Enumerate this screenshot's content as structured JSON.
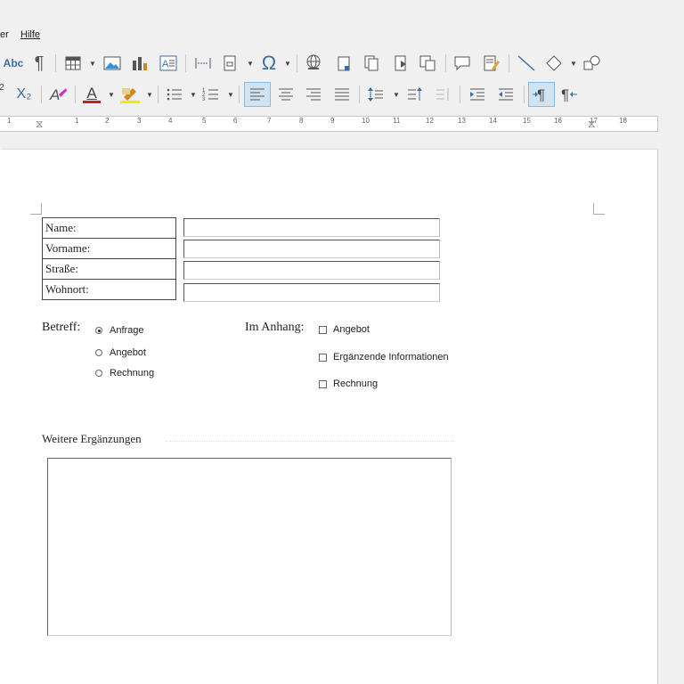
{
  "menu": {
    "item_partial": "er",
    "help": "Hilfe"
  },
  "toolbar1": {
    "spelling_icon": "Abc",
    "pilcrow_icon": "¶",
    "special_char_icon": "Ω"
  },
  "toolbar2": {
    "superscript_icon": "2",
    "subscript_icon": "X₂",
    "font_color_icon": "A",
    "highlight_color": "#f6e600",
    "font_color_bar": "#c9211e"
  },
  "ruler": {
    "numbers": [
      "1",
      "1",
      "2",
      "3",
      "4",
      "5",
      "6",
      "7",
      "8",
      "9",
      "10",
      "11",
      "12",
      "13",
      "14",
      "15",
      "16",
      "17",
      "18"
    ]
  },
  "form": {
    "personal_labels": [
      "Name:",
      "Vorname:",
      "Straße:",
      "Wohnort:"
    ],
    "subject_label": "Betreff:",
    "subject_options": [
      {
        "label": "Anfrage",
        "selected": true
      },
      {
        "label": "Angebot",
        "selected": false
      },
      {
        "label": "Rechnung",
        "selected": false
      }
    ],
    "attachment_label": "Im Anhang:",
    "attachment_options": [
      {
        "label": "Angebot",
        "checked": false
      },
      {
        "label": "Ergänzende Informationen",
        "checked": false
      },
      {
        "label": "Rechnung",
        "checked": false
      }
    ],
    "remarks_label": "Weitere Ergänzungen"
  }
}
